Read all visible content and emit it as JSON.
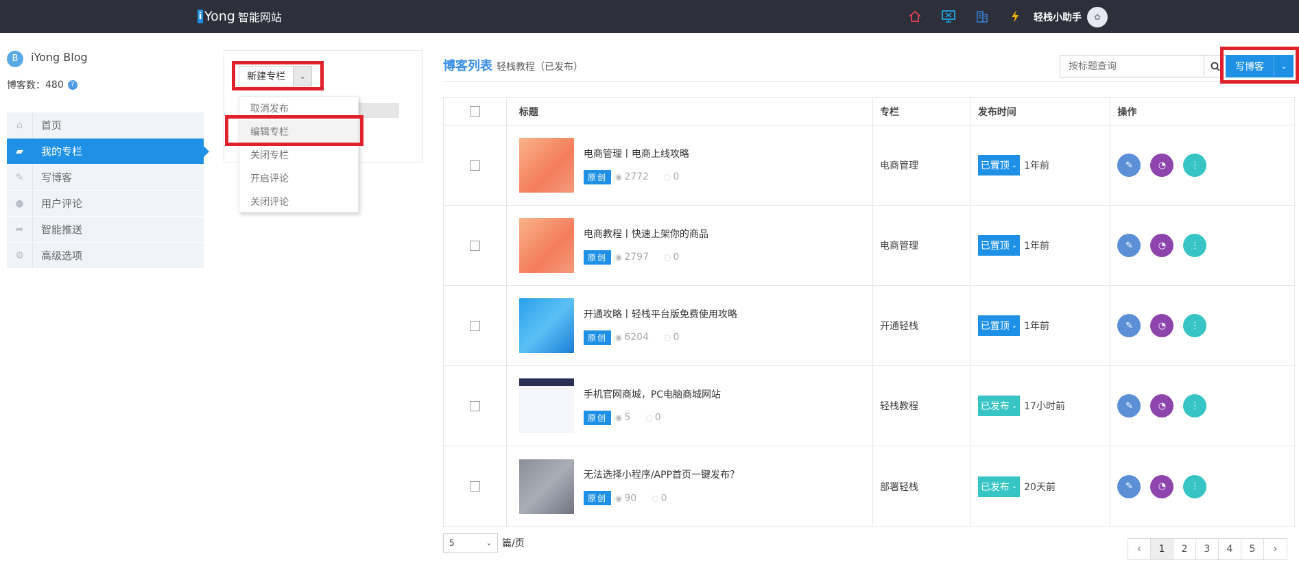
{
  "topbar": {
    "logo_i": "i",
    "logo_text": "Yong",
    "logo_suffix": "智能网站",
    "user_name": "轻栈小助手",
    "icons": [
      "home-icon",
      "monitor-icon",
      "building-icon",
      "lightning-icon"
    ],
    "colors": {
      "home": "#e0444e",
      "monitor": "#1ea6e6",
      "building": "#3a7fd0",
      "lightning": "#f4b400"
    }
  },
  "blog": {
    "initial": "B",
    "name": "iYong Blog",
    "count_label": "博客数：",
    "count": "480"
  },
  "sidebar": {
    "items": [
      {
        "label": "首页",
        "icon": "home-icon",
        "active": false
      },
      {
        "label": "我的专栏",
        "icon": "folder-open-icon",
        "active": true
      },
      {
        "label": "写博客",
        "icon": "edit-icon",
        "active": false
      },
      {
        "label": "用户评论",
        "icon": "comment-icon",
        "active": false
      },
      {
        "label": "智能推送",
        "icon": "share-icon",
        "active": false
      },
      {
        "label": "高级选项",
        "icon": "gears-icon",
        "active": false
      }
    ]
  },
  "column_panel": {
    "new_column_label": "新建专栏",
    "menu": [
      "取消发布",
      "编辑专栏",
      "关闭专栏",
      "开启评论",
      "关闭评论"
    ]
  },
  "list": {
    "title": "博客列表",
    "subtitle": "轻栈教程（已发布）",
    "search_placeholder": "按标题查询",
    "write_label": "写博客",
    "headers": [
      "",
      "标题",
      "专栏",
      "发布时间",
      "操作"
    ],
    "rows": [
      {
        "title": "电商管理丨电商上线攻略",
        "tag": "原创",
        "views": "2772",
        "comments": "0",
        "column": "电商管理",
        "status": "已置顶",
        "time": "1年前",
        "thumb": "orange"
      },
      {
        "title": "电商教程丨快速上架你的商品",
        "tag": "原创",
        "views": "2797",
        "comments": "0",
        "column": "电商管理",
        "status": "已置顶",
        "time": "1年前",
        "thumb": "orange"
      },
      {
        "title": "开通攻略丨轻栈平台版免费使用攻略",
        "tag": "原创",
        "views": "6204",
        "comments": "0",
        "column": "开通轻栈",
        "status": "已置顶",
        "time": "1年前",
        "thumb": "blue"
      },
      {
        "title": "手机官网商城，PC电脑商城网站",
        "tag": "原创",
        "views": "5",
        "comments": "0",
        "column": "轻栈教程",
        "status": "已发布",
        "time": "17小时前",
        "thumb": "screen"
      },
      {
        "title": "无法选择小程序/APP首页一键发布？",
        "tag": "原创",
        "views": "90",
        "comments": "0",
        "column": "部署轻栈",
        "status": "已发布",
        "time": "20天前",
        "thumb": "gray"
      }
    ]
  },
  "pagination": {
    "per_page": "5",
    "per_page_unit": "篇/页",
    "prev": "‹",
    "next": "›",
    "pages": [
      "1",
      "2",
      "3",
      "4",
      "5"
    ],
    "current": "1"
  },
  "status_colors": {
    "已置顶": "#1e90e6",
    "已发布": "#36c4c4"
  },
  "op_colors": [
    "#5b8fd6",
    "#8e44ad",
    "#36c4c4"
  ]
}
